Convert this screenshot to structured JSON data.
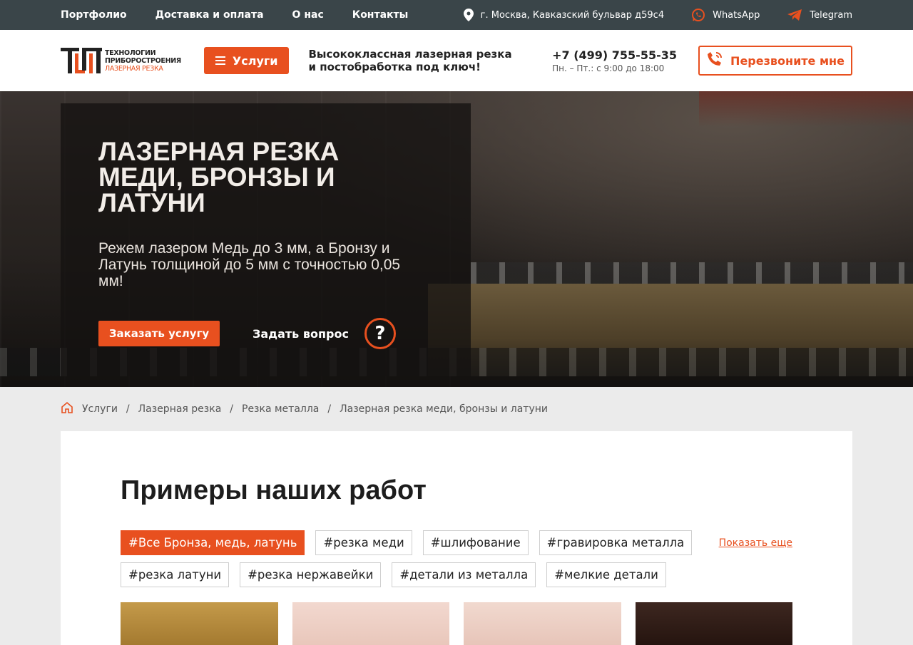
{
  "topbar": {
    "nav": [
      "Портфолио",
      "Доставка и оплата",
      "О нас",
      "Контакты"
    ],
    "address": "г. Москва, Кавказский бульвар д59с4",
    "whatsapp": "WhatsApp",
    "telegram": "Telegram"
  },
  "header": {
    "logo_line1": "ТЕХНОЛОГИИ",
    "logo_line2": "ПРИБОРОСТРОЕНИЯ",
    "logo_line3": "ЛАЗЕРНАЯ РЕЗКА",
    "services_label": "Услуги",
    "tagline": "Высококлассная лазерная резка и постобработка под ключ!",
    "phone": "+7 (499) 755-55-35",
    "hours": "Пн. – Пт.: с 9:00 до 18:00",
    "callback_label": "Перезвоните мне"
  },
  "hero": {
    "title": "ЛАЗЕРНАЯ РЕЗКА МЕДИ, БРОНЗЫ И ЛАТУНИ",
    "subtitle": "Режем лазером Медь до 3 мм, а Бронзу и Латунь толщиной до 5 мм с точностью 0,05 мм!",
    "order_label": "Заказать услугу",
    "ask_label": "Задать вопрос",
    "ask_icon": "?"
  },
  "breadcrumb": [
    "Услуги",
    "Лазерная резка",
    "Резка металла",
    "Лазерная резка меди, бронзы и латуни"
  ],
  "works": {
    "title": "Примеры наших работ",
    "tags_row1": [
      "#Все Бронза, медь, латунь",
      "#резка меди",
      "#шлифование",
      "#гравировка металла"
    ],
    "tags_row2": [
      "#резка латуни",
      "#резка нержавейки",
      "#детали из металла",
      "#мелкие детали"
    ],
    "show_more": "Показать еще"
  },
  "colors": {
    "accent": "#e8501f",
    "topbar": "#3a4549"
  }
}
